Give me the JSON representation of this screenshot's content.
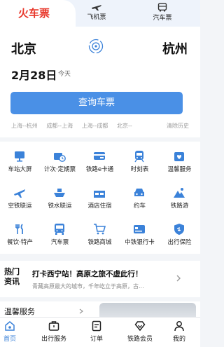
{
  "tabs": {
    "active": "火车票",
    "flight": "飞机票",
    "bus": "汽车票"
  },
  "booking": {
    "from_city": "北京",
    "to_city": "杭州",
    "date": "2月28日",
    "weekday": "今天",
    "query_button": "查询车票",
    "history": [
      "上海--杭州",
      "成都--上海",
      "上海--成都",
      "北京--"
    ],
    "clear_history": "清除历史"
  },
  "services": [
    {
      "label": "车站大屏",
      "icon": "station-screen-icon"
    },
    {
      "label": "计次·定期票",
      "icon": "ticket-clock-icon"
    },
    {
      "label": "铁路e卡通",
      "icon": "card-icon"
    },
    {
      "label": "时刻表",
      "icon": "train-icon"
    },
    {
      "label": "温馨服务",
      "icon": "heart-bag-icon"
    },
    {
      "label": "空铁联运",
      "icon": "plane-icon"
    },
    {
      "label": "铁水联运",
      "icon": "ship-icon"
    },
    {
      "label": "酒店住宿",
      "icon": "hotel-icon"
    },
    {
      "label": "约车",
      "icon": "car-icon"
    },
    {
      "label": "铁路游",
      "icon": "mountain-icon"
    },
    {
      "label": "餐饮·特产",
      "icon": "cutlery-icon"
    },
    {
      "label": "汽车票",
      "icon": "bus-icon"
    },
    {
      "label": "铁路商城",
      "icon": "cart-icon"
    },
    {
      "label": "中铁银行卡",
      "icon": "bank-card-icon"
    },
    {
      "label": "出行保险",
      "icon": "shield-icon"
    }
  ],
  "news": {
    "tag": "热门资讯",
    "title": "打卡西宁站！高原之旅不虚此行！",
    "subtitle": "青藏高原最大的城市，千年屹立于高原，古..."
  },
  "service_section": {
    "title": "温馨服务"
  },
  "bottom_nav": [
    {
      "label": "首页",
      "icon": "home-icon",
      "active": true
    },
    {
      "label": "出行服务",
      "icon": "briefcase-icon",
      "active": false
    },
    {
      "label": "订单",
      "icon": "order-icon",
      "active": false
    },
    {
      "label": "铁路会员",
      "icon": "diamond-icon",
      "active": false
    },
    {
      "label": "我的",
      "icon": "user-icon",
      "active": false
    }
  ],
  "colors": {
    "accent_red": "#e8372b",
    "primary_blue": "#4a90e6",
    "icon_blue": "#3b82d9"
  }
}
